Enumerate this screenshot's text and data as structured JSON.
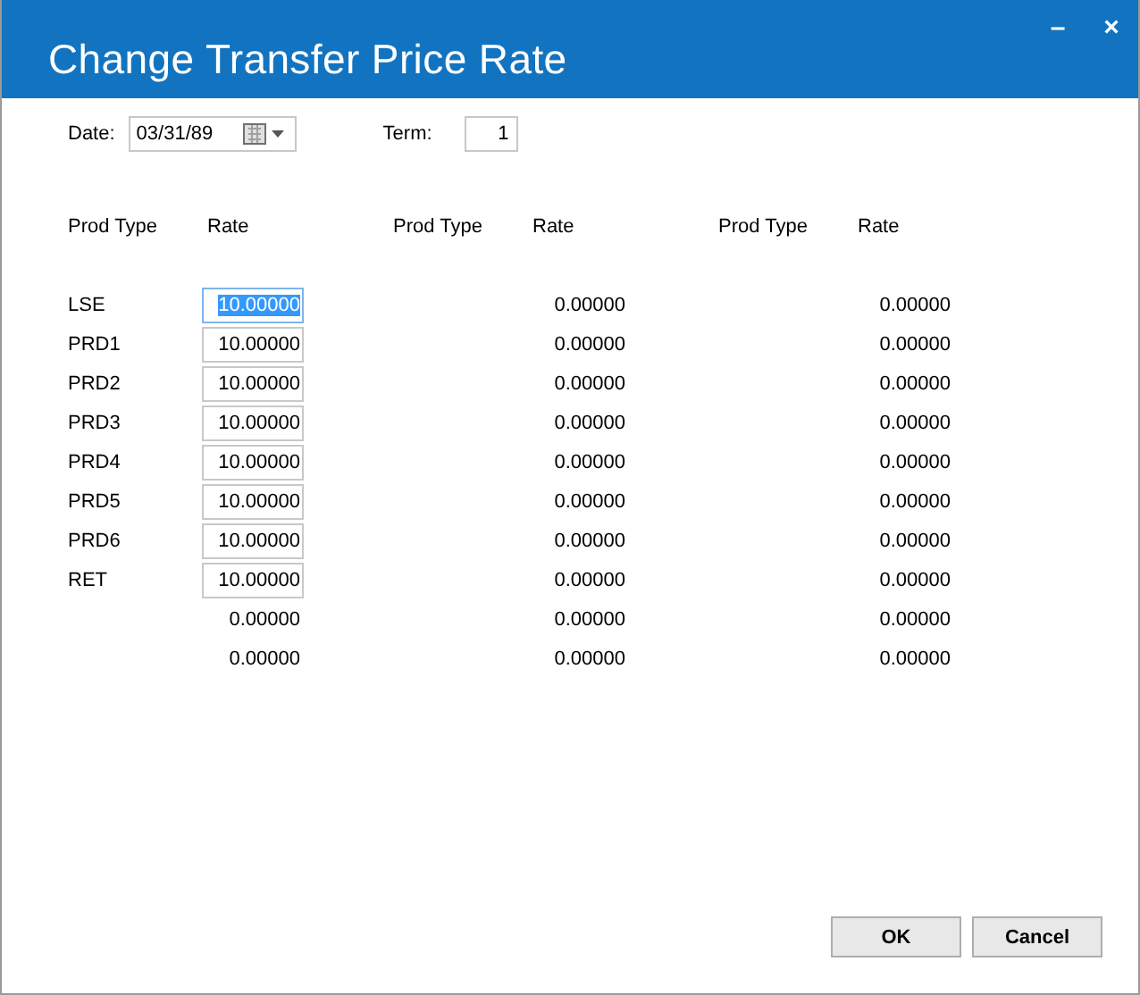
{
  "window": {
    "title": "Change Transfer Price Rate",
    "controls": [
      "–",
      "×"
    ]
  },
  "date": {
    "label": "Date:",
    "value": "03/31/89"
  },
  "term": {
    "label": "Term:",
    "value": "1"
  },
  "groups": [
    {
      "header_type": "Prod Type",
      "header_rate": "Rate",
      "rows": [
        {
          "prod_type": "LSE",
          "rate": "10.00000",
          "kind": "field",
          "selected": true
        },
        {
          "prod_type": "PRD1",
          "rate": "10.00000",
          "kind": "field",
          "selected": false
        },
        {
          "prod_type": "PRD2",
          "rate": "10.00000",
          "kind": "field",
          "selected": false
        },
        {
          "prod_type": "PRD3",
          "rate": "10.00000",
          "kind": "field",
          "selected": false
        },
        {
          "prod_type": "PRD4",
          "rate": "10.00000",
          "kind": "field",
          "selected": false
        },
        {
          "prod_type": "PRD5",
          "rate": "10.00000",
          "kind": "field",
          "selected": false
        },
        {
          "prod_type": "PRD6",
          "rate": "10.00000",
          "kind": "field",
          "selected": false
        },
        {
          "prod_type": "RET",
          "rate": "10.00000",
          "kind": "field",
          "selected": false
        },
        {
          "rate": "0.00000",
          "kind": "plain"
        },
        {
          "rate": "0.00000",
          "kind": "plain"
        }
      ]
    },
    {
      "header_type": "Prod Type",
      "header_rate": "Rate",
      "rows": [
        {
          "rate": "0.00000",
          "kind": "plain"
        },
        {
          "rate": "0.00000",
          "kind": "plain"
        },
        {
          "rate": "0.00000",
          "kind": "plain"
        },
        {
          "rate": "0.00000",
          "kind": "plain"
        },
        {
          "rate": "0.00000",
          "kind": "plain"
        },
        {
          "rate": "0.00000",
          "kind": "plain"
        },
        {
          "rate": "0.00000",
          "kind": "plain"
        },
        {
          "rate": "0.00000",
          "kind": "plain"
        },
        {
          "rate": "0.00000",
          "kind": "plain"
        },
        {
          "rate": "0.00000",
          "kind": "plain"
        }
      ]
    },
    {
      "header_type": "Prod Type",
      "header_rate": "Rate",
      "rows": [
        {
          "rate": "0.00000",
          "kind": "plain"
        },
        {
          "rate": "0.00000",
          "kind": "plain"
        },
        {
          "rate": "0.00000",
          "kind": "plain"
        },
        {
          "rate": "0.00000",
          "kind": "plain"
        },
        {
          "rate": "0.00000",
          "kind": "plain"
        },
        {
          "rate": "0.00000",
          "kind": "plain"
        },
        {
          "rate": "0.00000",
          "kind": "plain"
        },
        {
          "rate": "0.00000",
          "kind": "plain"
        },
        {
          "rate": "0.00000",
          "kind": "plain"
        },
        {
          "rate": "0.00000",
          "kind": "plain"
        }
      ]
    }
  ],
  "buttons": [
    "OK",
    "Cancel"
  ]
}
